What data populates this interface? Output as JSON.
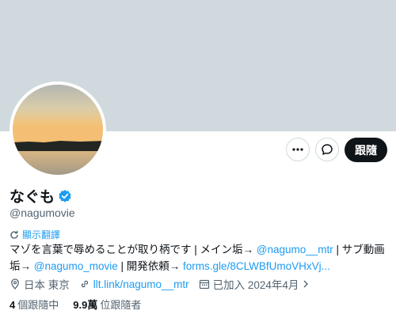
{
  "profile": {
    "name": "なぐも",
    "handle": "@nagumovie",
    "follow_label": "跟隨",
    "translate_label": "顯示翻譯",
    "bio": {
      "part1": "マゾを言葉で辱めることが取り柄です | メイン垢→ ",
      "mention1": "@nagumo__mtr",
      "part2": " | サブ動画垢→ ",
      "mention2": "@nagumo_movie",
      "part3": " | 開発依頼→ ",
      "link": "forms.gle/8CLWBfUmoVHxVj..."
    },
    "location": "日本 東京",
    "website": "llt.link/nagumo__mtr",
    "joined": "已加入 2024年4月",
    "following_count": "4",
    "following_label": "個跟隨中",
    "followers_count": "9.9萬",
    "followers_label": "位跟隨者"
  },
  "colors": {
    "accent": "#1d9bf0",
    "banner": "#cfd9de",
    "text": "#0f1419",
    "muted": "#536471"
  }
}
